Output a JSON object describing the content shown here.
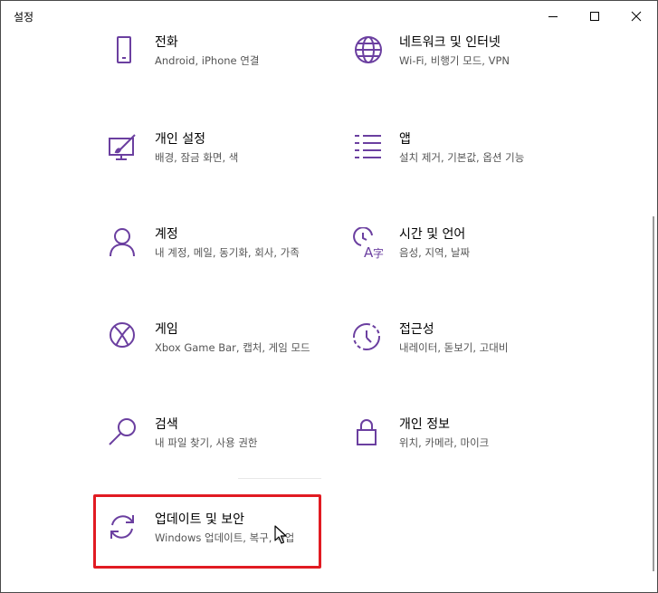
{
  "window": {
    "title": "설정",
    "controls": [
      "minimize-icon",
      "maximize-icon",
      "close-icon"
    ]
  },
  "colors": {
    "accent": "#6b3fa0",
    "highlight_border": "#e11b22",
    "description": "#555555"
  },
  "tiles": [
    {
      "name": "전화",
      "desc": "Android, iPhone 연결",
      "icon": "phone-icon"
    },
    {
      "name": "네트워크 및 인터넷",
      "desc": "Wi-Fi, 비행기 모드, VPN",
      "icon": "globe-icon"
    },
    {
      "name": "개인 설정",
      "desc": "배경, 잠금 화면, 색",
      "icon": "personalization-icon"
    },
    {
      "name": "앱",
      "desc": "설치 제거, 기본값, 옵션 기능",
      "icon": "apps-list-icon"
    },
    {
      "name": "계정",
      "desc": "내 계정, 메일, 동기화, 회사, 가족",
      "icon": "person-icon"
    },
    {
      "name": "시간 및 언어",
      "desc": "음성, 지역, 날짜",
      "icon": "time-language-icon"
    },
    {
      "name": "게임",
      "desc": "Xbox Game Bar, 캡처, 게임 모드",
      "icon": "xbox-icon"
    },
    {
      "name": "접근성",
      "desc": "내레이터, 돋보기, 고대비",
      "icon": "ease-of-access-icon"
    },
    {
      "name": "검색",
      "desc": "내 파일 찾기, 사용 권한",
      "icon": "search-icon"
    },
    {
      "name": "개인 정보",
      "desc": "위치, 카메라, 마이크",
      "icon": "lock-icon"
    },
    {
      "name": "업데이트 및 보안",
      "desc": "Windows 업데이트, 복구, 백업",
      "icon": "sync-icon"
    }
  ]
}
